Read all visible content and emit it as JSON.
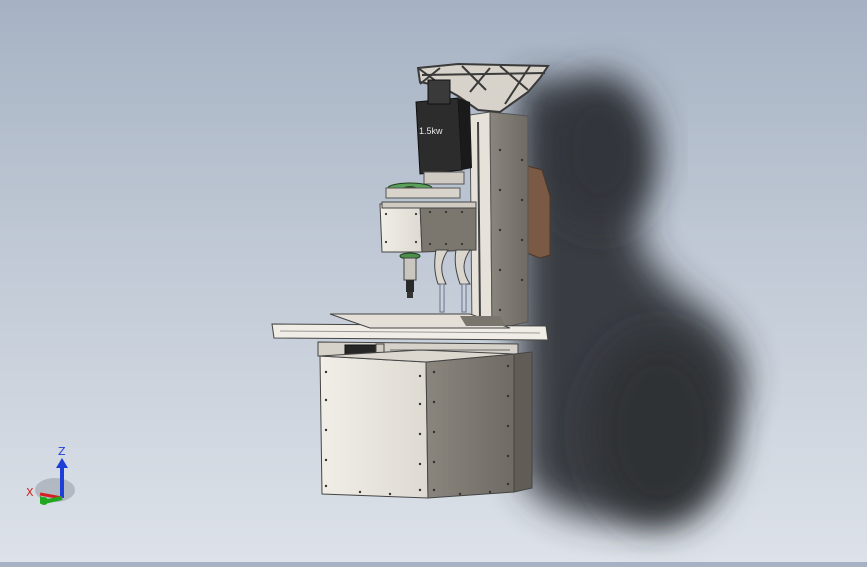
{
  "model": {
    "motor_label": "1.5kw"
  },
  "triad": {
    "z_label": "Z",
    "x_label": "X",
    "colors": {
      "z": "#1d3fd8",
      "x": "#d42020",
      "y": "#1fa81f"
    }
  },
  "colors": {
    "background_top": "#a6b2c3",
    "background_bottom": "#dde2e9",
    "panel_light": "#ece9e1",
    "panel_dark": "#7e7a72",
    "motor": "#2a2a2a",
    "shadow": "#34373c"
  }
}
